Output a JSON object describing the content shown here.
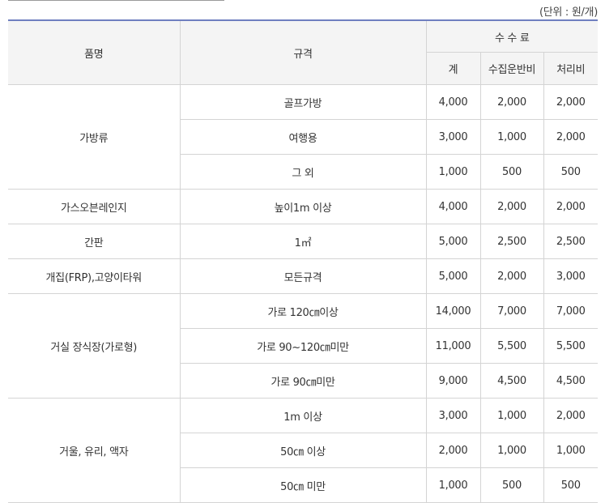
{
  "unit_label": "(단위 : 원/개)",
  "headers": {
    "item": "품명",
    "spec": "규격",
    "fee_group": "수 수 료",
    "total": "계",
    "collection": "수집운반비",
    "processing": "처리비"
  },
  "groups": [
    {
      "name": "가방류",
      "rows": [
        {
          "spec": "골프가방",
          "total": "4,000",
          "collection": "2,000",
          "processing": "2,000"
        },
        {
          "spec": "여행용",
          "total": "3,000",
          "collection": "1,000",
          "processing": "2,000"
        },
        {
          "spec": "그 외",
          "total": "1,000",
          "collection": "500",
          "processing": "500"
        }
      ]
    },
    {
      "name": "가스오븐레인지",
      "rows": [
        {
          "spec": "높이1m 이상",
          "total": "4,000",
          "collection": "2,000",
          "processing": "2,000"
        }
      ]
    },
    {
      "name": "간판",
      "rows": [
        {
          "spec": "1㎡",
          "total": "5,000",
          "collection": "2,500",
          "processing": "2,500"
        }
      ]
    },
    {
      "name": "개집(FRP),고양이타워",
      "rows": [
        {
          "spec": "모든규격",
          "total": "5,000",
          "collection": "2,000",
          "processing": "3,000"
        }
      ]
    },
    {
      "name": "거실 장식장(가로형)",
      "rows": [
        {
          "spec": "가로 120㎝이상",
          "total": "14,000",
          "collection": "7,000",
          "processing": "7,000"
        },
        {
          "spec": "가로 90~120㎝미만",
          "total": "11,000",
          "collection": "5,500",
          "processing": "5,500"
        },
        {
          "spec": "가로 90㎝미만",
          "total": "9,000",
          "collection": "4,500",
          "processing": "4,500"
        }
      ]
    },
    {
      "name": "거울, 유리, 액자",
      "rows": [
        {
          "spec": "1m 이상",
          "total": "3,000",
          "collection": "1,000",
          "processing": "2,000"
        },
        {
          "spec": "50㎝ 이상",
          "total": "2,000",
          "collection": "1,000",
          "processing": "1,000"
        },
        {
          "spec": "50㎝ 미만",
          "total": "1,000",
          "collection": "500",
          "processing": "500"
        }
      ]
    }
  ]
}
